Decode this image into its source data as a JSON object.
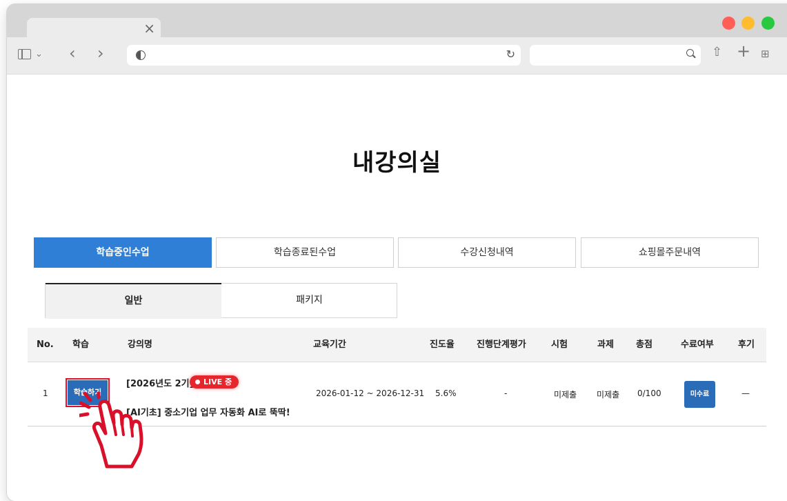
{
  "page": {
    "title": "내강의실"
  },
  "main_tabs": [
    {
      "label": "학습중인수업",
      "active": true
    },
    {
      "label": "학습종료된수업",
      "active": false
    },
    {
      "label": "수강신청내역",
      "active": false
    },
    {
      "label": "쇼핑몰주문내역",
      "active": false
    }
  ],
  "sub_tabs": [
    {
      "label": "일반",
      "active": true
    },
    {
      "label": "패키지",
      "active": false
    }
  ],
  "table": {
    "headers": [
      "No.",
      "학습",
      "강의명",
      "교육기간",
      "진도율",
      "진행단계평가",
      "시험",
      "과제",
      "총점",
      "수료여부",
      "후기"
    ],
    "rows": [
      {
        "no": "1",
        "study_button": "학습하기",
        "cohort": "[2026년도 2기]",
        "live_badge": "LIVE 중",
        "course_title": "[AI기초] 중소기업 업무 자동화 AI로 뚝딱!",
        "period": "2026-01-12 ~ 2026-12-31",
        "progress": "5.6%",
        "stage_eval": "-",
        "exam": "미제출",
        "assignment": "미제출",
        "total": "0/100",
        "completion": "미수료",
        "review": "—"
      }
    ]
  },
  "colors": {
    "accent_blue": "#2f7fd6",
    "button_blue": "#2b6cb8",
    "live_red": "#e5262d",
    "highlight_red": "#e0102a"
  },
  "icons": [
    "close-icon",
    "sidebar-icon",
    "chevron-down-icon",
    "back-icon",
    "forward-icon",
    "privacy-shield-icon",
    "reload-icon",
    "search-icon",
    "share-icon",
    "plus-icon",
    "tab-grid-icon",
    "hand-pointer-icon"
  ]
}
